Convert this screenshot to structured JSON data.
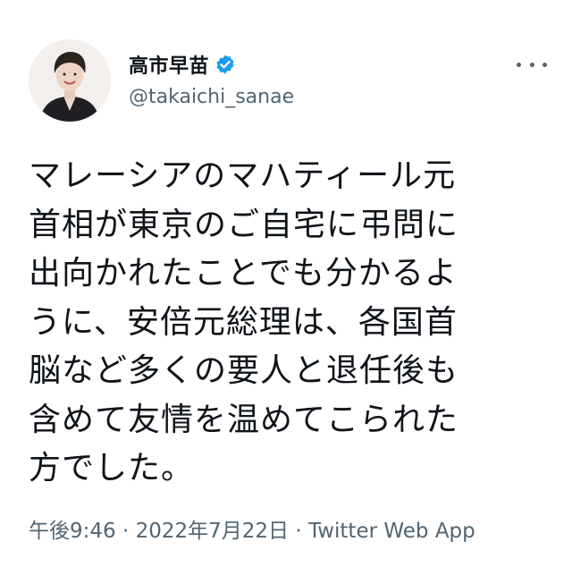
{
  "colors": {
    "accent": "#1d9bf0",
    "secondary_text": "#536471",
    "primary_text": "#0f1419"
  },
  "author": {
    "display_name": "高市早苗",
    "handle": "@takaichi_sanae",
    "verified_icon": "verified-badge-icon",
    "avatar": "profile-avatar"
  },
  "more_icon": "more-horizontal-icon",
  "tweet": {
    "text": "マレーシアのマハティール元\n首相が東京のご自宅に弔問に\n出向かれたことでも分かるよ\nうに、安倍元総理は、各国首\n脳など多くの要人と退任後も\n含めて友情を温めてこられた\n方でした。",
    "time": "午後9:46",
    "separator1": " · ",
    "date": "2022年7月22日",
    "separator2": " · ",
    "source": "Twitter Web App"
  }
}
